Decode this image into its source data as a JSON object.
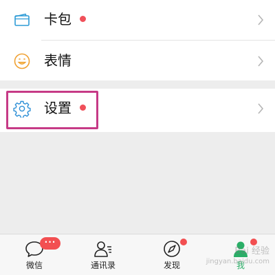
{
  "menu": {
    "items": [
      {
        "label": "卡包",
        "icon": "card-wallet-icon",
        "has_dot": true
      },
      {
        "label": "表情",
        "icon": "emoji-icon",
        "has_dot": false
      },
      {
        "label": "设置",
        "icon": "gear-icon",
        "has_dot": true
      }
    ]
  },
  "tabbar": {
    "tabs": [
      {
        "label": "微信",
        "icon": "chat-bubble-icon",
        "badge": "···"
      },
      {
        "label": "通讯录",
        "icon": "contacts-icon"
      },
      {
        "label": "发现",
        "icon": "compass-icon",
        "has_dot": true
      },
      {
        "label": "我",
        "icon": "profile-icon",
        "has_dot": true,
        "active": true
      }
    ]
  },
  "watermark": {
    "line1": "Bai 经验",
    "line2": "jingyan.baidu.com"
  },
  "colors": {
    "background": "#ededed",
    "dot": "#f0505a",
    "highlight": "#c63a86",
    "active_tab": "#2aae67",
    "badge": "#f24f51"
  }
}
